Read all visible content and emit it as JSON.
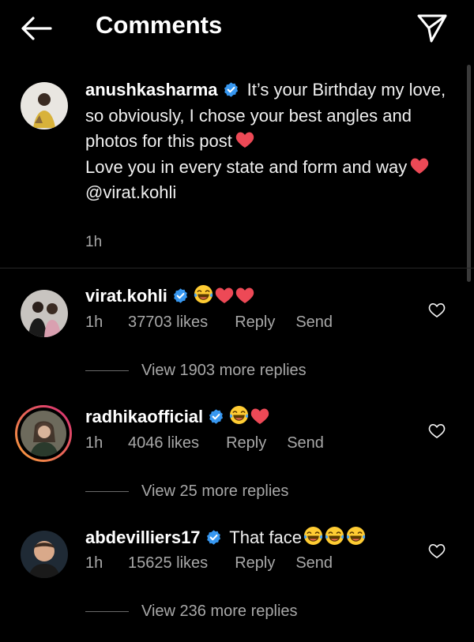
{
  "header": {
    "title": "Comments",
    "back_icon": "arrow-left-icon",
    "share_icon": "paper-plane-icon"
  },
  "caption": {
    "username": "anushkasharma",
    "text_1": "It’s your Birthday my love, so obviously, I chose your best angles and photos for this post",
    "text_2": "Love you in every state and form and way",
    "mention": "@virat.kohli",
    "time": "1h"
  },
  "comments": [
    {
      "username": "virat.kohli",
      "text": "",
      "time": "1h",
      "likes": "37703 likes",
      "reply": "Reply",
      "send": "Send",
      "view_replies": "View 1903 more replies"
    },
    {
      "username": "radhikaofficial",
      "text": "",
      "time": "1h",
      "likes": "4046 likes",
      "reply": "Reply",
      "send": "Send",
      "view_replies": "View 25 more replies"
    },
    {
      "username": "abdevilliers17",
      "text": "That face",
      "time": "1h",
      "likes": "15625 likes",
      "reply": "Reply",
      "send": "Send",
      "view_replies": "View 236 more replies"
    }
  ],
  "colors": {
    "background": "#000000",
    "verified": "#3797f0",
    "heart": "#ed4956",
    "secondary_text": "#a8a8a8",
    "story_ring_start": "#f9a13a",
    "story_ring_end": "#d62976"
  }
}
